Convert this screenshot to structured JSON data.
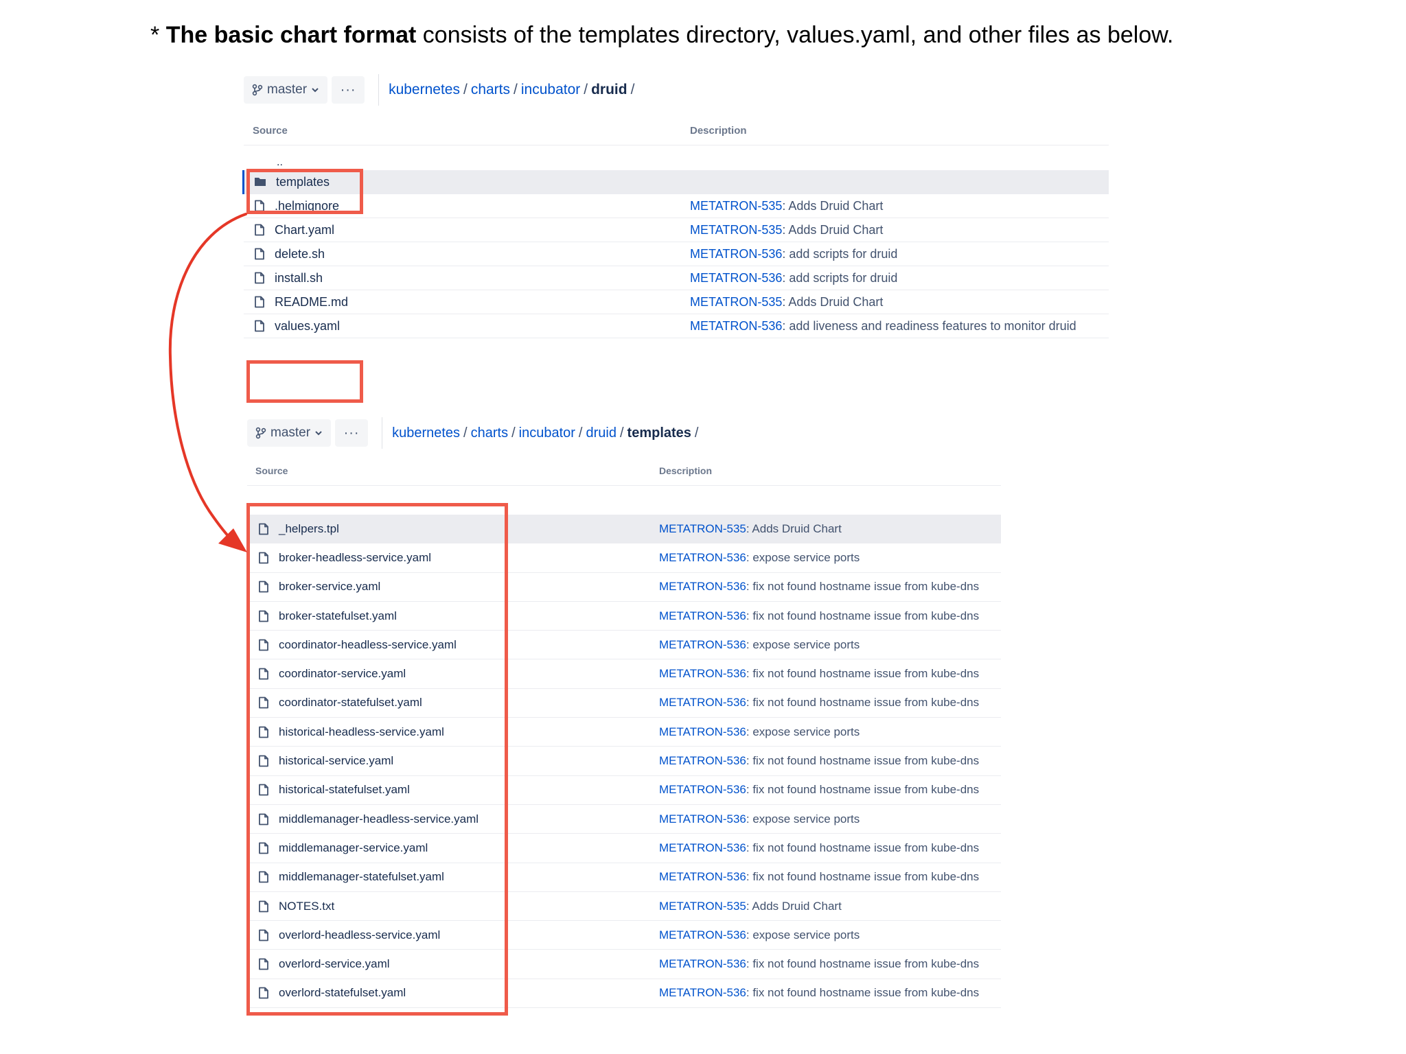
{
  "caption": {
    "bullet": "* ",
    "bold": "The basic chart format",
    "rest": " consists of the templates directory, values.yaml, and other files as below."
  },
  "colors": {
    "link": "#0052cc",
    "text": "#172b4d",
    "muted": "#6b778c",
    "highlight": "#ef5b4a",
    "arrow": "#e53727",
    "selected_row": "#ebecf0"
  },
  "icons": {
    "branch": "git-branch-icon",
    "chevron": "chevron-down-icon",
    "more": "more-icon",
    "folder": "folder-icon",
    "file": "file-icon"
  },
  "top_panel": {
    "branch": "master",
    "more": "···",
    "breadcrumb": {
      "parts": [
        "kubernetes",
        "charts",
        "incubator"
      ],
      "current": "druid",
      "sep": "/"
    },
    "headers": {
      "source": "Source",
      "description": "Description"
    },
    "parent": "..",
    "rows": [
      {
        "name": "templates",
        "key": "",
        "desc": "",
        "type": "folder"
      },
      {
        "name": ".helmignore",
        "key": "METATRON-535",
        "desc": ": Adds Druid Chart",
        "type": "file"
      },
      {
        "name": "Chart.yaml",
        "key": "METATRON-535",
        "desc": ": Adds Druid Chart",
        "type": "file"
      },
      {
        "name": "delete.sh",
        "key": "METATRON-536",
        "desc": ": add scripts for druid",
        "type": "file"
      },
      {
        "name": "install.sh",
        "key": "METATRON-536",
        "desc": ": add scripts for druid",
        "type": "file"
      },
      {
        "name": "README.md",
        "key": "METATRON-535",
        "desc": ": Adds Druid Chart",
        "type": "file"
      },
      {
        "name": "values.yaml",
        "key": "METATRON-536",
        "desc": ": add liveness and readiness features to monitor druid",
        "type": "file"
      }
    ]
  },
  "bottom_panel": {
    "branch": "master",
    "more": "···",
    "breadcrumb": {
      "parts": [
        "kubernetes",
        "charts",
        "incubator",
        "druid"
      ],
      "current": "templates",
      "sep": "/"
    },
    "headers": {
      "source": "Source",
      "description": "Description"
    },
    "rows": [
      {
        "name": "_helpers.tpl",
        "key": "METATRON-535",
        "desc": ": Adds Druid Chart"
      },
      {
        "name": "broker-headless-service.yaml",
        "key": "METATRON-536",
        "desc": ": expose service ports"
      },
      {
        "name": "broker-service.yaml",
        "key": "METATRON-536",
        "desc": ": fix not found hostname issue from kube-dns"
      },
      {
        "name": "broker-statefulset.yaml",
        "key": "METATRON-536",
        "desc": ": fix not found hostname issue from kube-dns"
      },
      {
        "name": "coordinator-headless-service.yaml",
        "key": "METATRON-536",
        "desc": ": expose service ports"
      },
      {
        "name": "coordinator-service.yaml",
        "key": "METATRON-536",
        "desc": ": fix not found hostname issue from kube-dns"
      },
      {
        "name": "coordinator-statefulset.yaml",
        "key": "METATRON-536",
        "desc": ": fix not found hostname issue from kube-dns"
      },
      {
        "name": "historical-headless-service.yaml",
        "key": "METATRON-536",
        "desc": ": expose service ports"
      },
      {
        "name": "historical-service.yaml",
        "key": "METATRON-536",
        "desc": ": fix not found hostname issue from kube-dns"
      },
      {
        "name": "historical-statefulset.yaml",
        "key": "METATRON-536",
        "desc": ": fix not found hostname issue from kube-dns"
      },
      {
        "name": "middlemanager-headless-service.yaml",
        "key": "METATRON-536",
        "desc": ": expose service ports"
      },
      {
        "name": "middlemanager-service.yaml",
        "key": "METATRON-536",
        "desc": ": fix not found hostname issue from kube-dns"
      },
      {
        "name": "middlemanager-statefulset.yaml",
        "key": "METATRON-536",
        "desc": ": fix not found hostname issue from kube-dns"
      },
      {
        "name": "NOTES.txt",
        "key": "METATRON-535",
        "desc": ": Adds Druid Chart"
      },
      {
        "name": "overlord-headless-service.yaml",
        "key": "METATRON-536",
        "desc": ": expose service ports"
      },
      {
        "name": "overlord-service.yaml",
        "key": "METATRON-536",
        "desc": ": fix not found hostname issue from kube-dns"
      },
      {
        "name": "overlord-statefulset.yaml",
        "key": "METATRON-536",
        "desc": ": fix not found hostname issue from kube-dns"
      }
    ]
  }
}
